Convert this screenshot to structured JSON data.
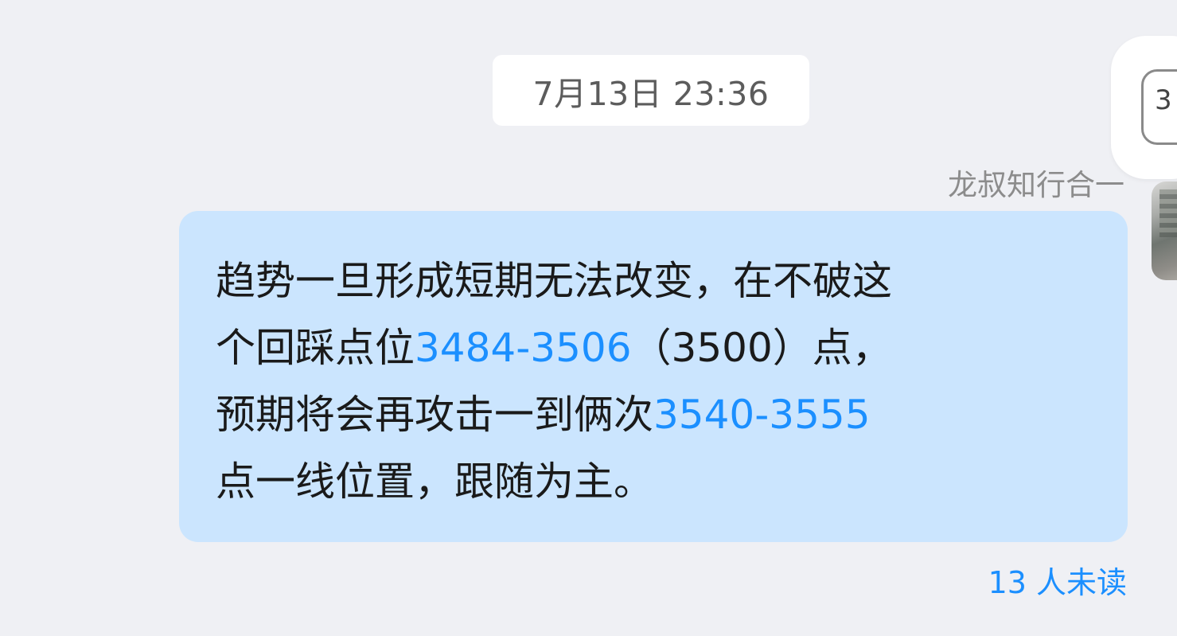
{
  "chat": {
    "timestamp": "7月13日 23:36",
    "floating_badge_text": "3",
    "sender_name": "龙叔知行合一",
    "message": {
      "line1": "趋势一旦形成短期无法改变，在不破这",
      "line2_pre": "个回踩点位",
      "line2_link": "3484-3506",
      "line2_post": "（3500）点，",
      "line3_pre": "预期将会再攻击一到俩次",
      "line3_link": "3540-3555",
      "line4": "点一线位置，跟随为主。"
    },
    "read_receipt": "13 人未读"
  },
  "colors": {
    "background": "#eff0f4",
    "bubble": "#cbe5fe",
    "link": "#1b8fff",
    "text": "#1a1a1a",
    "muted": "#8c8c8c"
  }
}
